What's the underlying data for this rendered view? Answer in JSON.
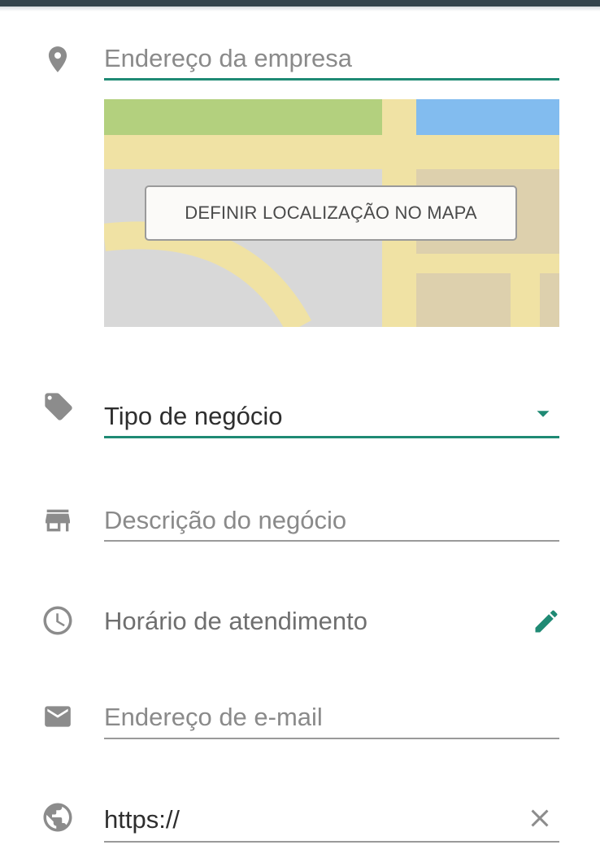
{
  "form": {
    "address": {
      "placeholder": "Endereço da empresa"
    },
    "map": {
      "button_label": "DEFINIR LOCALIZAÇÃO NO MAPA"
    },
    "business_type": {
      "value": "Tipo de negócio"
    },
    "description": {
      "placeholder": "Descrição do negócio"
    },
    "hours": {
      "label": "Horário de atendimento"
    },
    "email": {
      "placeholder": "Endereço de e-mail"
    },
    "website": {
      "value": "https://"
    }
  },
  "icons": {
    "address": "location-pin-icon",
    "business_type": "tag-icon",
    "description": "store-icon",
    "hours": "clock-icon",
    "email": "envelope-icon",
    "website": "globe-icon",
    "dropdown": "dropdown-arrow-icon",
    "edit": "pencil-icon",
    "clear": "close-icon"
  },
  "colors": {
    "accent": "#1f8a74",
    "icon_gray": "#8c8c8c",
    "top_bar": "#34454c"
  }
}
